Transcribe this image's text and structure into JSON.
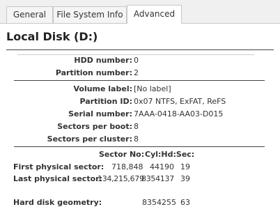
{
  "tabs": [
    {
      "label": "General"
    },
    {
      "label": "File System Info"
    },
    {
      "label": "Advanced",
      "active": true
    }
  ],
  "title": "Local Disk (D:)",
  "section1": [
    {
      "label": "HDD number:",
      "value": "0"
    },
    {
      "label": "Partition number:",
      "value": "2"
    }
  ],
  "section2": [
    {
      "label": "Volume label:",
      "value": "[No label]"
    },
    {
      "label": "Partition ID:",
      "value": "0x07 NTFS, ExFAT, ReFS"
    },
    {
      "label": "Serial number:",
      "value": "7AAA-0418-AA03-D015"
    },
    {
      "label": "Sectors per boot:",
      "value": "8"
    },
    {
      "label": "Sectors per cluster:",
      "value": "8"
    }
  ],
  "geometry": {
    "header_sector": "Sector No:",
    "header_chs": "Cyl:Hd:Sec:",
    "first": {
      "label": "First physical sector:",
      "sector": "718,848",
      "cyl": "44190",
      "sec": "19"
    },
    "last": {
      "label": "Last physical sector:",
      "sector": "134,215,679",
      "cyl": "8354137",
      "sec": "39"
    },
    "hard_disk": {
      "label": "Hard disk geometry:",
      "cyl": "8354255",
      "sec": "63"
    }
  }
}
